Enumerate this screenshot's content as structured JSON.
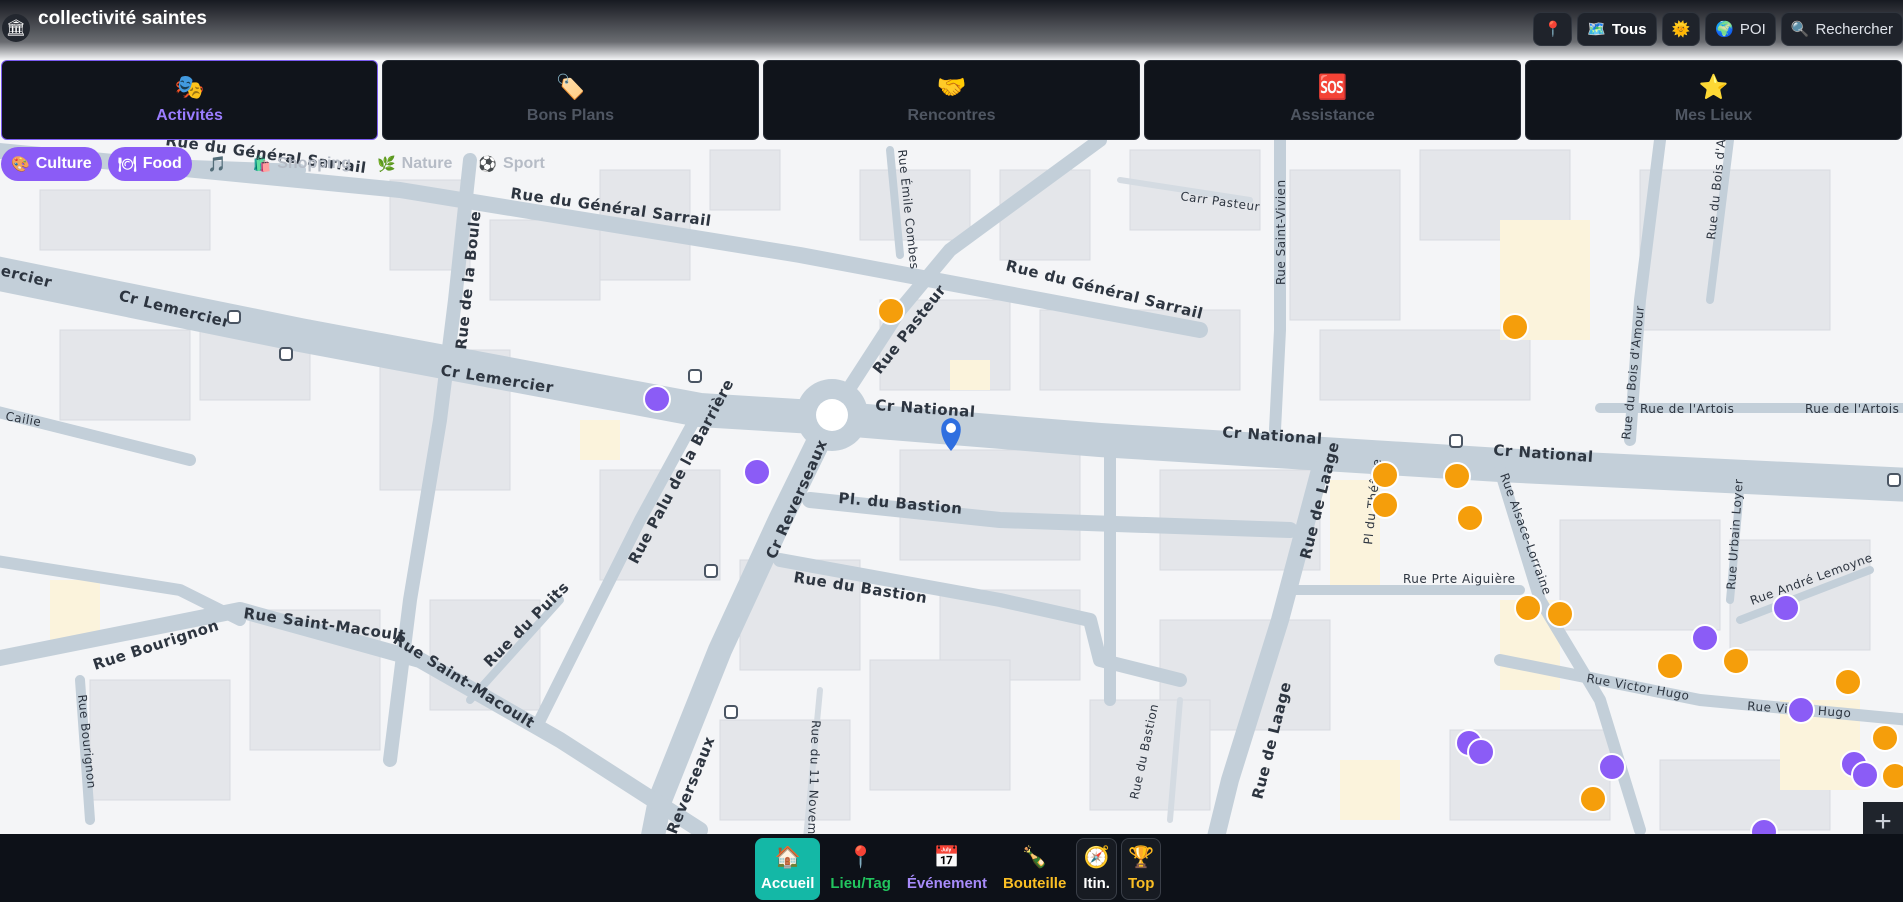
{
  "app": {
    "title": "collectivité saintes",
    "logo_icon": "🏛"
  },
  "toolbar": [
    {
      "name": "pin-icon-button",
      "icon": "📍",
      "label": ""
    },
    {
      "name": "tous-button",
      "icon": "🗺️",
      "label": "Tous"
    },
    {
      "name": "weather-button",
      "icon": "🌞",
      "label": ""
    },
    {
      "name": "poi-button",
      "icon": "🌍",
      "label": "POI"
    },
    {
      "name": "search-button",
      "icon": "🔍",
      "label": "Rechercher"
    }
  ],
  "categories": [
    {
      "icon": "🎭",
      "label": "Activités",
      "active": true
    },
    {
      "icon": "🏷️",
      "label": "Bons Plans",
      "active": false
    },
    {
      "icon": "🤝",
      "label": "Rencontres",
      "active": false
    },
    {
      "icon": "🆘",
      "label": "Assistance",
      "active": false
    },
    {
      "icon": "⭐",
      "label": "Mes Lieux",
      "active": false
    }
  ],
  "filters": [
    {
      "icon": "🎨",
      "label": "Culture",
      "active": true
    },
    {
      "icon": "🍽",
      "label": "Food",
      "active": true
    },
    {
      "icon": "🎵",
      "label": "",
      "active": false
    },
    {
      "icon": "🛍️",
      "label": "Shopping",
      "active": false
    },
    {
      "icon": "🌿",
      "label": "Nature",
      "active": false
    },
    {
      "icon": "⚽",
      "label": "Sport",
      "active": false
    }
  ],
  "bottom_nav": [
    {
      "icon": "🏠",
      "label": "Accueil",
      "color": "#ffffff",
      "style": "active"
    },
    {
      "icon": "📍",
      "label": "Lieu/Tag",
      "color": "#22c55e",
      "style": "plain"
    },
    {
      "icon": "📅",
      "label": "Événement",
      "color": "#a78bfa",
      "style": "plain"
    },
    {
      "icon": "🍾",
      "label": "Bouteille",
      "color": "#fbbf24",
      "style": "plain"
    },
    {
      "icon": "🧭",
      "label": "Itin.",
      "color": "#ffffff",
      "style": "bordered"
    },
    {
      "icon": "🏆",
      "label": "Top",
      "color": "#fbbf24",
      "style": "bordered"
    }
  ],
  "map": {
    "zoom_in_label": "+",
    "streets": [
      "Rue du Général Sarrail",
      "Rue du Général Sarrail",
      "Rue du Général Sarrail",
      "Cr Lemercier",
      "Cr Lemercier",
      "Cr Lemercier",
      "Cr National",
      "Cr National",
      "Cr National",
      "Rue Pasteur",
      "Rue Pasteur",
      "Carr Pasteur",
      "Rue Saint-Vivien",
      "Rue de la Boule",
      "Rue Émile Combes",
      "Rue Palu de la Barrière",
      "Cr Reverseaux",
      "Pl. du Bastion",
      "Rue du Bastion",
      "Rue du Bastion",
      "Rue du Puits",
      "Rue Saint-Macoult",
      "Rue Saint-Macoult",
      "Rue Bourignon",
      "Rue Bourignon",
      "Rue du 11 Novembre",
      "Reverseaux",
      "Rue de Laage",
      "Rue de Laage",
      "Rue Alsace-Lorraine",
      "Rue Prte Aiguière",
      "Rue Victor Hugo",
      "Rue Victor Hugo",
      "Rue de l'Artois",
      "Rue de l'Artois",
      "Rue du Bois d'Amour",
      "Rue du Bois d'Amour",
      "Rue Urbain Loyer",
      "Rue André Lemoyne",
      "Pl du Théâtre",
      "Cailie",
      "ercier",
      "Rue du Bastion"
    ]
  }
}
